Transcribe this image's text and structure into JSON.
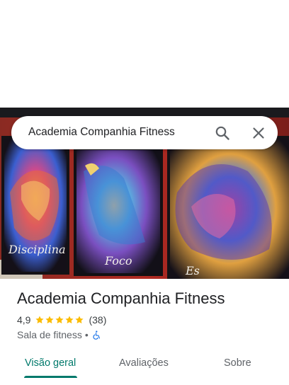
{
  "search": {
    "query": "Academia Companhia Fitness",
    "search_icon": "search-icon",
    "close_icon": "close-icon"
  },
  "photo": {
    "description_icon": "gym-wall-art-photo",
    "captions": [
      "Disciplina",
      "Foco",
      "Es"
    ]
  },
  "place": {
    "title": "Academia Companhia Fitness",
    "rating": "4,9",
    "stars_filled": 5,
    "review_count": "(38)",
    "category": "Sala de fitness",
    "separator": "•",
    "accessibility_icon": "wheelchair-icon"
  },
  "tabs": [
    {
      "label": "Visão geral",
      "active": true
    },
    {
      "label": "Avaliações",
      "active": false
    },
    {
      "label": "Sobre",
      "active": false
    }
  ],
  "colors": {
    "accent": "#00796b",
    "star": "#fbbc04",
    "accessibility": "#1a73e8"
  }
}
